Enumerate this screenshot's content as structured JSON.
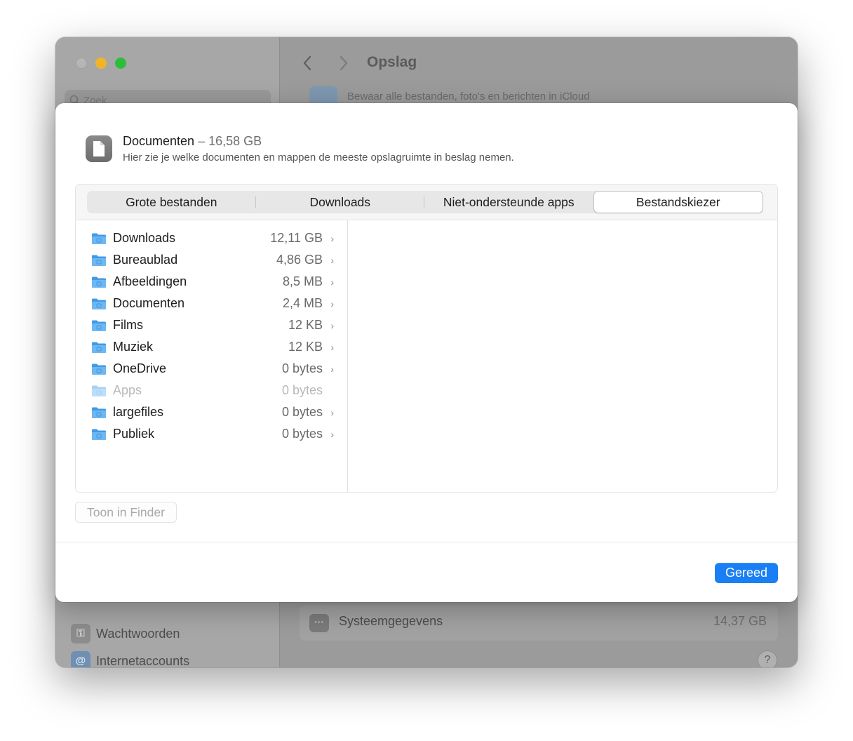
{
  "background_window": {
    "title": "Opslag",
    "search_placeholder": "Zoek",
    "icloud_text": "Bewaar alle bestanden, foto's en berichten in iCloud",
    "sidebar_items": [
      {
        "label": "Wachtwoorden",
        "icon": "key-icon"
      },
      {
        "label": "Internetaccounts",
        "icon": "at-icon"
      }
    ],
    "storage_row": {
      "label": "Systeemgegevens",
      "size": "14,37 GB",
      "icon": "ellipsis-icon"
    },
    "help_label": "?"
  },
  "sheet": {
    "title": "Documenten",
    "size": "– 16,58 GB",
    "subtitle": "Hier zie je welke documenten en mappen de meeste opslagruimte in beslag nemen.",
    "tabs": [
      {
        "label": "Grote bestanden",
        "selected": false
      },
      {
        "label": "Downloads",
        "selected": false
      },
      {
        "label": "Niet-ondersteunde apps",
        "selected": false
      },
      {
        "label": "Bestandskiezer",
        "selected": true
      }
    ],
    "folders": [
      {
        "name": "Downloads",
        "size": "12,11 GB",
        "enabled": true,
        "icon": "downloads-folder-icon"
      },
      {
        "name": "Bureaublad",
        "size": "4,86 GB",
        "enabled": true,
        "icon": "desktop-folder-icon"
      },
      {
        "name": "Afbeeldingen",
        "size": "8,5 MB",
        "enabled": true,
        "icon": "pictures-folder-icon"
      },
      {
        "name": "Documenten",
        "size": "2,4 MB",
        "enabled": true,
        "icon": "documents-folder-icon"
      },
      {
        "name": "Films",
        "size": "12 KB",
        "enabled": true,
        "icon": "movies-folder-icon"
      },
      {
        "name": "Muziek",
        "size": "12 KB",
        "enabled": true,
        "icon": "music-folder-icon"
      },
      {
        "name": "OneDrive",
        "size": "0 bytes",
        "enabled": true,
        "icon": "alias-folder-icon"
      },
      {
        "name": "Apps",
        "size": "0 bytes",
        "enabled": false,
        "icon": "apps-folder-icon"
      },
      {
        "name": "largefiles",
        "size": "0 bytes",
        "enabled": true,
        "icon": "folder-icon"
      },
      {
        "name": "Publiek",
        "size": "0 bytes",
        "enabled": true,
        "icon": "public-folder-icon"
      }
    ],
    "show_in_finder_label": "Toon in Finder",
    "done_label": "Gereed"
  },
  "colors": {
    "accent": "#1a7ff4",
    "folder_blue": "#3f9be8",
    "traffic_min": "#f0b428",
    "traffic_max": "#2ebd3a"
  }
}
